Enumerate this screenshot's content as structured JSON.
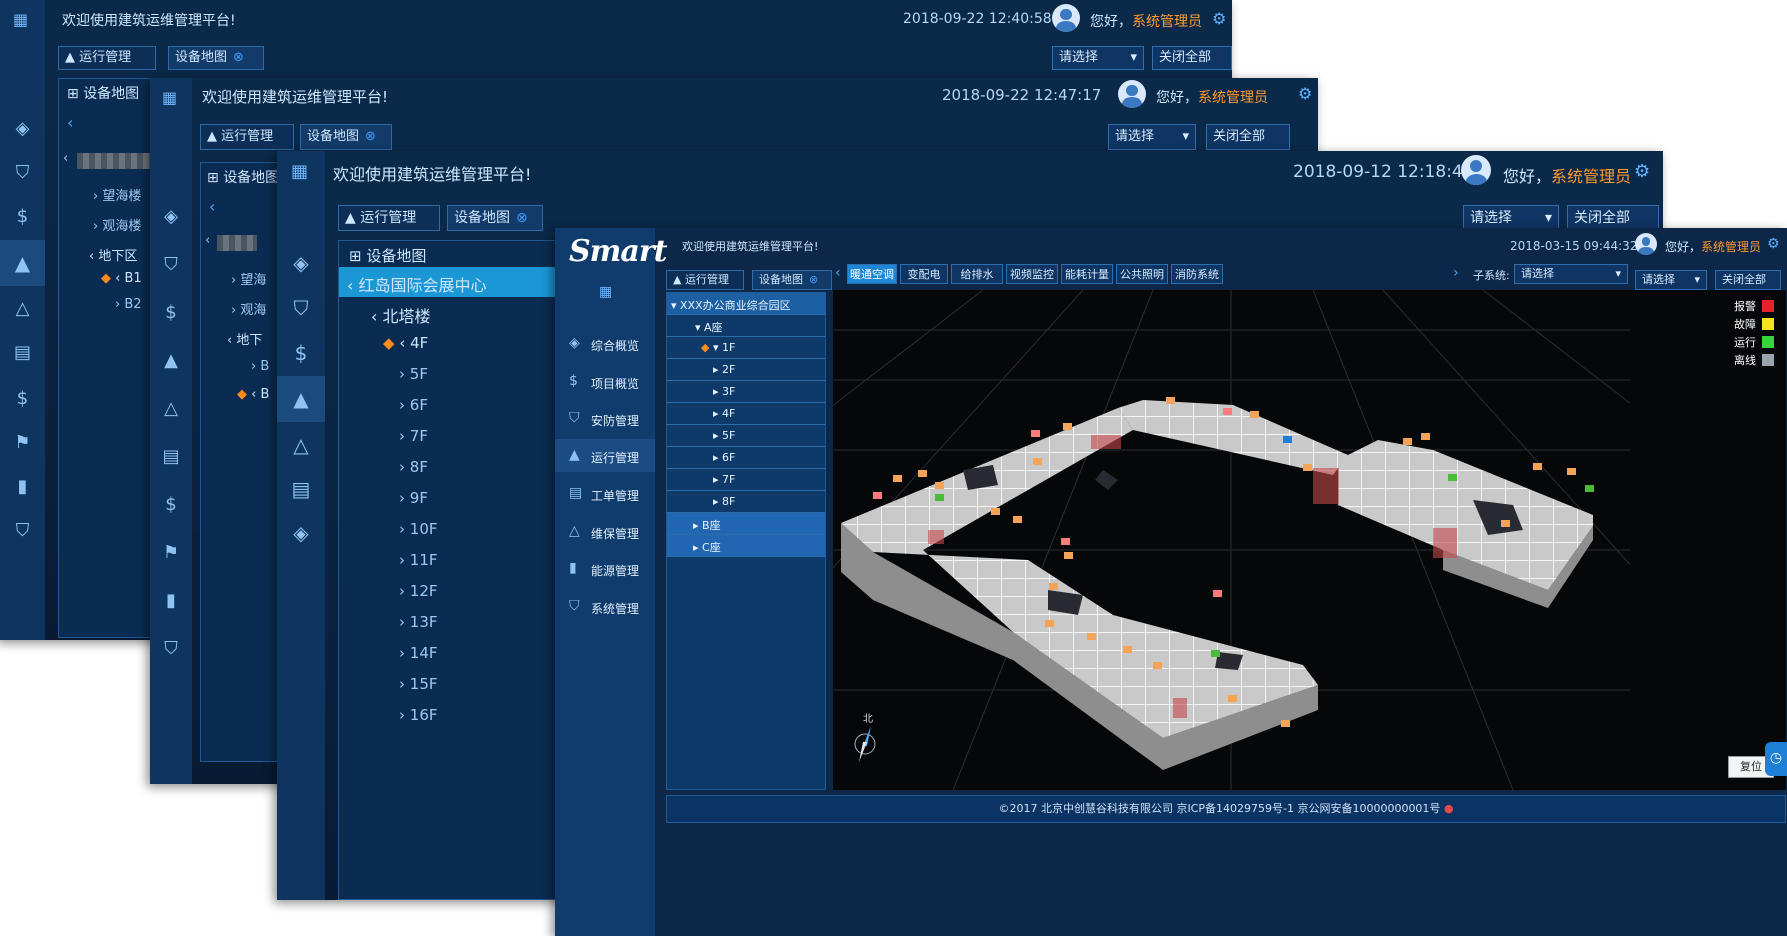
{
  "common": {
    "welcome": "欢迎使用建筑运维管理平台!",
    "hello": "您好，",
    "admin_name": "系统管理员",
    "tab_ops": "运行管理",
    "tab_map": "设备地图",
    "select_placeholder": "请选择",
    "close_all": "关闭全部",
    "panel_title": "设备地图",
    "close_glyph": "⊗"
  },
  "win1": {
    "datetime": "2018-09-22 12:40:58",
    "tree": [
      "望海楼",
      "观海楼",
      "地下区",
      "B1",
      "B2"
    ]
  },
  "win2": {
    "datetime": "2018-09-22 12:47:17",
    "tree": [
      "望海",
      "观海",
      "地下",
      "B",
      "B"
    ]
  },
  "win3": {
    "datetime": "2018-09-12 12:18:46",
    "root": "红岛国际会展中心",
    "building": "北塔楼",
    "floors": [
      "4F",
      "5F",
      "6F",
      "7F",
      "8F",
      "9F",
      "10F",
      "11F",
      "12F",
      "13F",
      "14F",
      "15F",
      "16F"
    ]
  },
  "win4": {
    "logo": "Smart",
    "datetime": "2018-03-15 09:44:32",
    "nav": [
      {
        "label": "综合概览",
        "icon": "layers-icon"
      },
      {
        "label": "项目概览",
        "icon": "dollar-icon"
      },
      {
        "label": "安防管理",
        "icon": "shield-icon"
      },
      {
        "label": "运行管理",
        "icon": "ops-icon"
      },
      {
        "label": "工单管理",
        "icon": "clipboard-icon"
      },
      {
        "label": "维保管理",
        "icon": "cone-icon"
      },
      {
        "label": "能源管理",
        "icon": "chart-icon"
      },
      {
        "label": "系统管理",
        "icon": "shield-icon"
      }
    ],
    "tree_root": "XXX办公商业综合园区",
    "building_a": "A座",
    "floors": [
      "1F",
      "2F",
      "3F",
      "4F",
      "5F",
      "6F",
      "7F",
      "8F"
    ],
    "building_b": "B座",
    "building_c": "C座",
    "systems": [
      "暖通空调",
      "变配电",
      "给排水",
      "视频监控",
      "能耗计量",
      "公共照明",
      "消防系统"
    ],
    "subsystem_label": "子系统:",
    "subsystem_select": "请选择",
    "legend": [
      {
        "label": "报警",
        "color": "#e8222a"
      },
      {
        "label": "故障",
        "color": "#f2e31d"
      },
      {
        "label": "运行",
        "color": "#36d63a"
      },
      {
        "label": "离线",
        "color": "#9aa3ad"
      }
    ],
    "north": "北",
    "reset": "复位",
    "footer": "©2017 北京中创慧谷科技有限公司   京ICP备14029759号-1   京公网安备10000000001号"
  }
}
